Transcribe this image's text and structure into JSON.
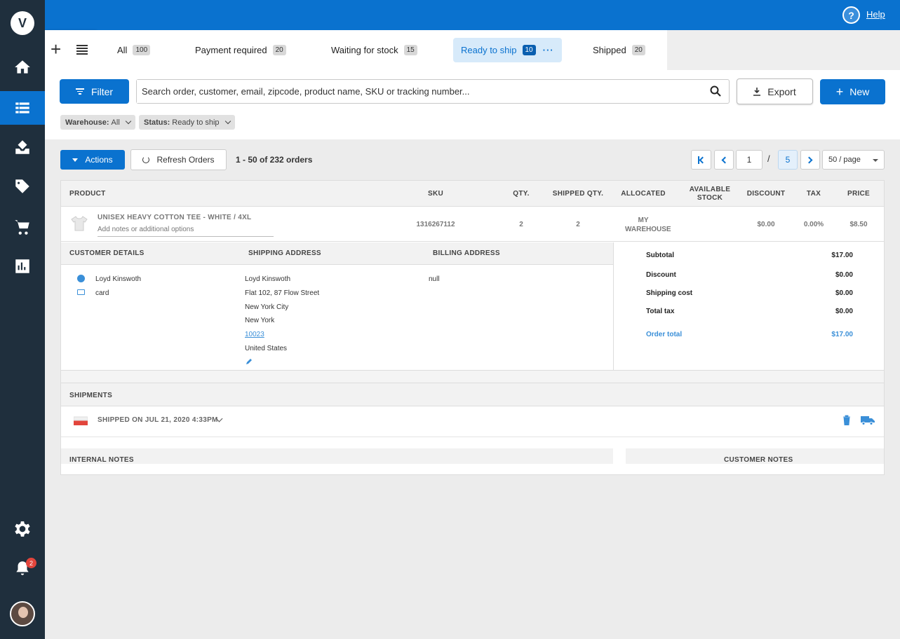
{
  "app": {
    "logo_text": "V"
  },
  "sidebar": {
    "items": [
      {
        "name": "home",
        "icon": "home-icon"
      },
      {
        "name": "orders",
        "icon": "list-icon",
        "active": true
      },
      {
        "name": "inventory",
        "icon": "inbox-icon"
      },
      {
        "name": "products",
        "icon": "tag-icon"
      },
      {
        "name": "purchases",
        "icon": "cart-icon"
      },
      {
        "name": "reports",
        "icon": "chart-icon"
      },
      {
        "name": "settings",
        "icon": "gear-icon"
      },
      {
        "name": "notifications",
        "icon": "bell-icon"
      }
    ],
    "notification_count": "2"
  },
  "topbar": {
    "help_icon": "?",
    "help_label": "Help"
  },
  "tabs": [
    {
      "label": "All",
      "count": "100"
    },
    {
      "label": "Payment required",
      "count": "20"
    },
    {
      "label": "Waiting for stock",
      "count": "15"
    },
    {
      "label": "Ready to ship",
      "count": "10",
      "active": true,
      "more": "···"
    },
    {
      "label": "Shipped",
      "count": "20"
    }
  ],
  "toolbar": {
    "filter_label": "Filter",
    "search_placeholder": "Search order, customer, email, zipcode, product name, SKU or tracking number...",
    "export_label": "Export",
    "new_label": "New",
    "chips": [
      {
        "key": "Warehouse:",
        "value": "All"
      },
      {
        "key": "Status:",
        "value": "Ready to ship"
      }
    ]
  },
  "actions": {
    "actions_label": "Actions",
    "refresh_label": "Refresh Orders",
    "range_text": "1 - 50 of 232 orders"
  },
  "pagination": {
    "current": "1",
    "separator": "/",
    "total_pages": "5",
    "per_page": "50 / page"
  },
  "table": {
    "headers": {
      "product": "PRODUCT",
      "sku": "SKU",
      "qty": "QTY.",
      "shipped_qty": "SHIPPED QTY.",
      "allocated": "ALLOCATED",
      "available_stock": "AVAILABLE STOCK",
      "discount": "DISCOUNT",
      "tax": "TAX",
      "price": "PRICE"
    },
    "row": {
      "product": "UNISEX HEAVY COTTON TEE - WHITE / 4XL",
      "notes_placeholder": "Add notes or additional options",
      "sku": "1316267112",
      "qty": "2",
      "shipped_qty": "2",
      "allocated": "MY WAREHOUSE",
      "available_stock": "",
      "discount": "$0.00",
      "tax": "0.00%",
      "price": "$8.50"
    }
  },
  "details": {
    "headers": {
      "customer": "CUSTOMER DETAILS",
      "shipping": "SHIPPING ADDRESS",
      "billing": "BILLING ADDRESS"
    },
    "customer": {
      "name": "Loyd Kinswoth",
      "payment": "card"
    },
    "shipping": {
      "name": "Loyd Kinswoth",
      "line1": "Flat 102, 87 Flow Street",
      "city": "New York City",
      "state": "New York",
      "zip": "10023",
      "country": "United States"
    },
    "billing": {
      "value": "null"
    }
  },
  "summary": {
    "subtotal_label": "Subtotal",
    "subtotal": "$17.00",
    "discount_label": "Discount",
    "discount": "$0.00",
    "shipping_label": "Shipping cost",
    "shipping": "$0.00",
    "tax_label": "Total tax",
    "tax": "$0.00",
    "total_label": "Order total",
    "total": "$17.00"
  },
  "shipments": {
    "header": "SHIPMENTS",
    "shipped_text": "SHIPPED ON JUL 21, 2020 4:33PM"
  },
  "notes": {
    "internal": "INTERNAL NOTES",
    "customer": "CUSTOMER NOTES"
  },
  "colors": {
    "brand": "#0a72cf",
    "sidebar": "#1f2f3d",
    "accent_text": "#3a8fd8",
    "badge": "#e2453c"
  }
}
